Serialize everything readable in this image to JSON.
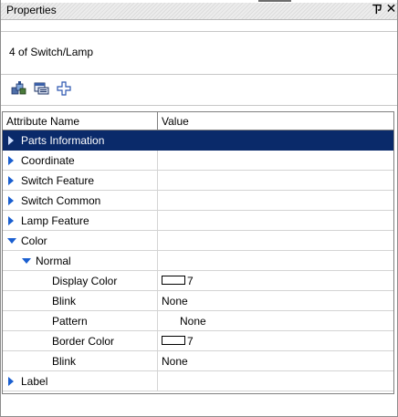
{
  "window": {
    "title": "Properties",
    "pin_glyph": "ㄗ",
    "close_glyph": "✕"
  },
  "object_name": "4 of Switch/Lamp",
  "toolbar": {
    "icons": [
      "category-icon",
      "sort-icon",
      "add-icon"
    ]
  },
  "grid": {
    "columns": [
      "Attribute Name",
      "Value"
    ],
    "rows": [
      {
        "label": "Parts Information",
        "value": "",
        "expander": "collapsed",
        "selected": true
      },
      {
        "label": "Coordinate",
        "value": "",
        "expander": "collapsed"
      },
      {
        "label": "Switch Feature",
        "value": "",
        "expander": "collapsed"
      },
      {
        "label": "Switch Common",
        "value": "",
        "expander": "collapsed"
      },
      {
        "label": "Lamp Feature",
        "value": "",
        "expander": "collapsed"
      },
      {
        "label": "Color",
        "value": "",
        "expander": "expanded"
      },
      {
        "label": "Normal",
        "value": "",
        "expander": "expanded"
      },
      {
        "label": "Display Color",
        "value": "7",
        "swatch": true
      },
      {
        "label": "Blink",
        "value": "None"
      },
      {
        "label": "Pattern",
        "value": "None"
      },
      {
        "label": "Border Color",
        "value": "7",
        "swatch": true
      },
      {
        "label": "Blink",
        "value": "None"
      },
      {
        "label": "Label",
        "value": "",
        "expander": "collapsed"
      }
    ]
  },
  "colors": {
    "selection": "#0a2a6a",
    "expander": "#1a5fd0"
  }
}
